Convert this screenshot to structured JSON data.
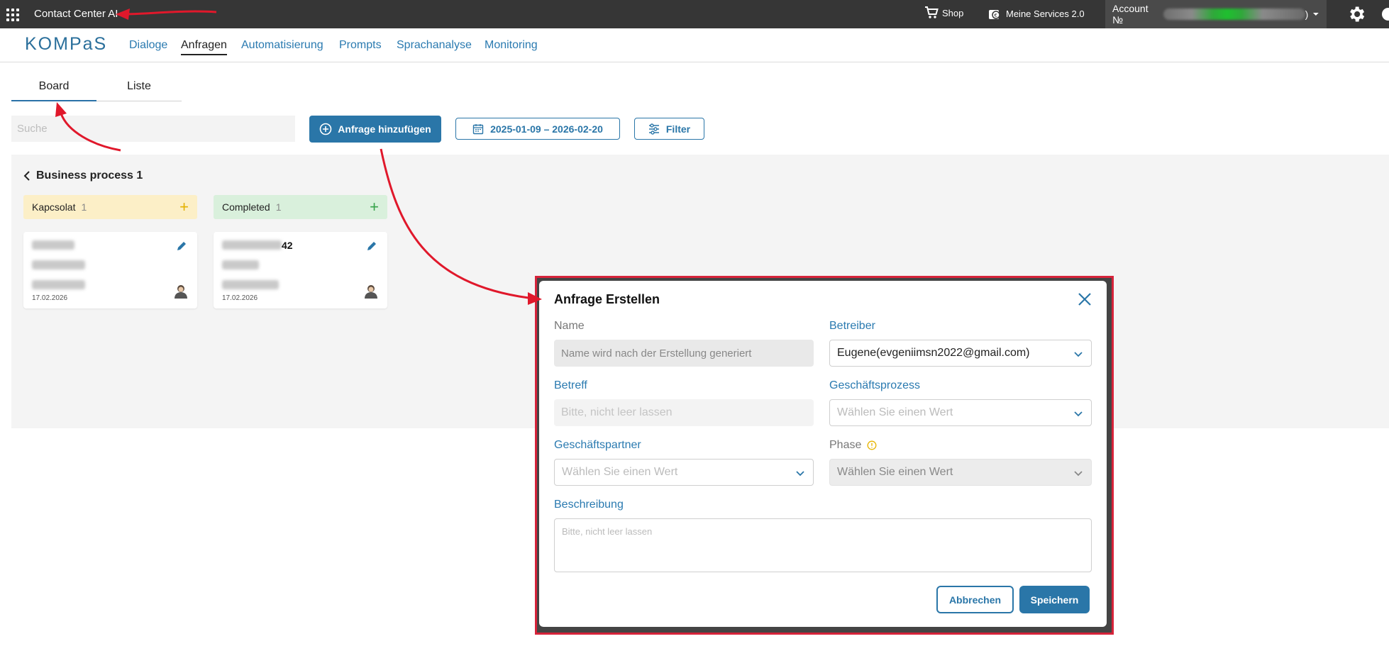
{
  "topbar": {
    "app_title": "Contact Center AI",
    "shop_label": "Shop",
    "services_label": "Meine Services 2.0",
    "account_label": "Account №",
    "account_suffix": ")"
  },
  "navbar": {
    "logo_text": "KOMPaS",
    "links": [
      "Dialoge",
      "Anfragen",
      "Automatisierung",
      "Prompts",
      "Sprachanalyse",
      "Monitoring"
    ],
    "active": "Anfragen"
  },
  "tabs": {
    "board": "Board",
    "list": "Liste"
  },
  "toolbar": {
    "search_placeholder": "Suche",
    "add_label": "Anfrage hinzufügen",
    "date_range": "2025-01-09 – 2026-02-20",
    "filter_label": "Filter"
  },
  "board": {
    "process_title": "Business process 1",
    "columns": [
      {
        "name": "Kapcsolat",
        "count": "1",
        "color": "#fcefc7",
        "plus_color": "#e3b100",
        "card": {
          "title_tail": "",
          "date": "17.02.2026"
        }
      },
      {
        "name": "Completed",
        "count": "1",
        "color": "#d9f0dc",
        "plus_color": "#37a24a",
        "card": {
          "title_tail": "42",
          "date": "17.02.2026"
        }
      }
    ]
  },
  "dialog": {
    "title": "Anfrage Erstellen",
    "name_label": "Name",
    "name_value": "Name wird nach der Erstellung generiert",
    "betreiber_label": "Betreiber",
    "betreiber_value": "Eugene(evgeniimsn2022@gmail.com)",
    "betreff_label": "Betreff",
    "betreff_placeholder": "Bitte, nicht leer lassen",
    "geschaeftsprozess_label": "Geschäftsprozess",
    "geschaeftsprozess_placeholder": "Wählen Sie einen Wert",
    "geschaeftspartner_label": "Geschäftspartner",
    "geschaeftspartner_placeholder": "Wählen Sie einen Wert",
    "phase_label": "Phase",
    "phase_placeholder": "Wählen Sie einen Wert",
    "beschreibung_label": "Beschreibung",
    "beschreibung_placeholder": "Bitte, nicht leer lassen",
    "cancel_label": "Abbrechen",
    "save_label": "Speichern"
  },
  "colors": {
    "primary": "#2a76a8",
    "topbar": "#363636",
    "annotation_red": "#e0182b"
  }
}
